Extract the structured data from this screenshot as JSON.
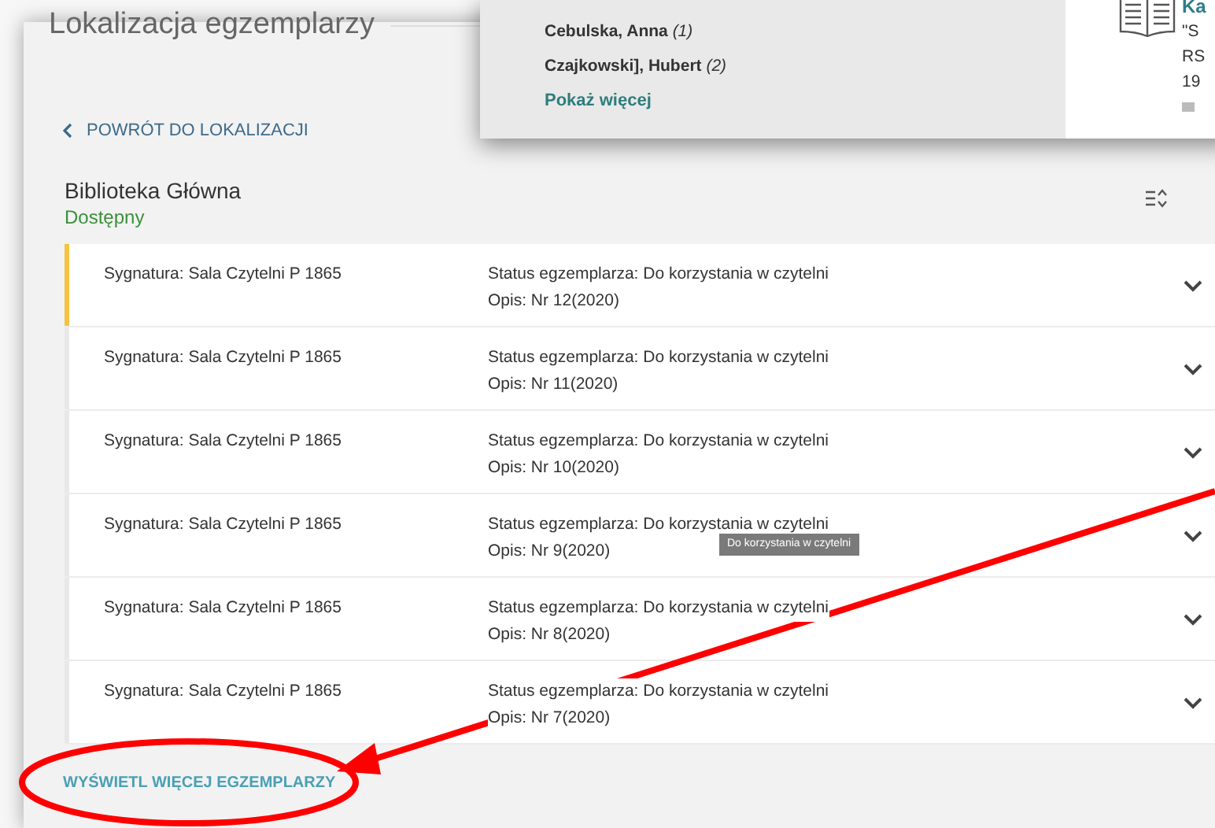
{
  "panel": {
    "title": "Lokalizacja egzemplarzy",
    "back_link": "POWRÓT DO LOKALIZACJI",
    "library": "Biblioteka Główna",
    "availability": "Dostępny",
    "items": [
      {
        "call_number": "Sygnatura: Sala Czytelni P 1865",
        "status": "Status egzemplarza: Do korzystania w czytelni",
        "description": "Opis: Nr 12(2020)",
        "selected": true
      },
      {
        "call_number": "Sygnatura: Sala Czytelni P 1865",
        "status": "Status egzemplarza: Do korzystania w czytelni",
        "description": "Opis: Nr 11(2020)",
        "selected": false
      },
      {
        "call_number": "Sygnatura: Sala Czytelni P 1865",
        "status": "Status egzemplarza: Do korzystania w czytelni",
        "description": "Opis: Nr 10(2020)",
        "selected": false
      },
      {
        "call_number": "Sygnatura: Sala Czytelni P 1865",
        "status": "Status egzemplarza: Do korzystania w czytelni",
        "description": "Opis: Nr 9(2020)",
        "selected": false,
        "tooltip": "Do korzystania w czytelni"
      },
      {
        "call_number": "Sygnatura: Sala Czytelni P 1865",
        "status": "Status egzemplarza: Do korzystania w czytelni",
        "description": "Opis: Nr 8(2020)",
        "selected": false
      },
      {
        "call_number": "Sygnatura: Sala Czytelni P 1865",
        "status": "Status egzemplarza: Do korzystania w czytelni",
        "description": "Opis: Nr 7(2020)",
        "selected": false
      }
    ],
    "show_more_button": "WYŚWIETL WIĘCEJ EGZEMPLARZY"
  },
  "popup": {
    "facets": [
      {
        "name": "Cebulska, Anna",
        "count": "(1)"
      },
      {
        "name": "Czajkowski], Hubert",
        "count": "(2)"
      }
    ],
    "show_more": "Pokaż więcej",
    "result": {
      "title": "Ka",
      "lines": [
        "\"S",
        "RS",
        "19"
      ]
    }
  }
}
